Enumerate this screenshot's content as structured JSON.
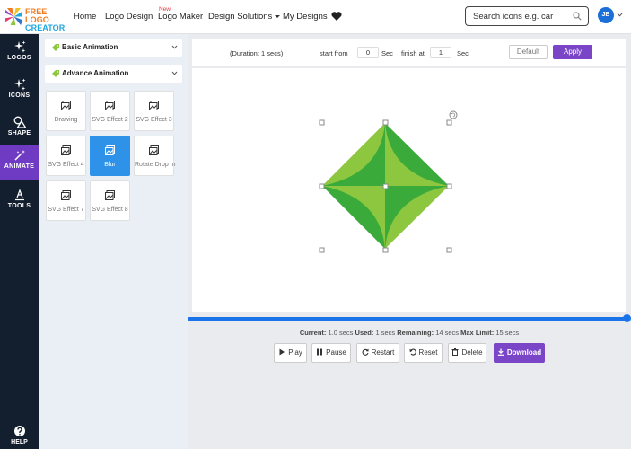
{
  "brand": {
    "line1": "FREE LOGO",
    "line2": "CREATOR"
  },
  "nav": {
    "home": "Home",
    "logo_design": "Logo Design",
    "logo_maker": "Logo Maker",
    "new_badge": "New",
    "design_solutions": "Design Solutions",
    "my_designs": "My Designs"
  },
  "search": {
    "placeholder": "Search icons e.g. car"
  },
  "user": {
    "initials": "JB"
  },
  "sidebar": {
    "items": [
      {
        "label": "LOGOS",
        "icon": "sparkle-icon"
      },
      {
        "label": "ICONS",
        "icon": "sparkle-icon"
      },
      {
        "label": "SHAPE",
        "icon": "shapes-icon"
      },
      {
        "label": "ANIMATE",
        "icon": "magic-wand-icon"
      },
      {
        "label": "TOOLS",
        "icon": "text-tool-icon"
      }
    ],
    "help": "HELP"
  },
  "panel": {
    "basic": "Basic Animation",
    "advance": "Advance Animation",
    "effects": [
      "Drawing",
      "SVG Effect 2",
      "SVG Effect 3",
      "SVG Effect 4",
      "Blur",
      "Rotate Drop In",
      "SVG Effect 7",
      "SVG Effect 8"
    ],
    "active": "Blur"
  },
  "toolbar": {
    "duration": "(Duration: 1 secs)",
    "start_from": "start from",
    "start_value": "0",
    "sec1": "Sec",
    "finish_at": "finish at",
    "finish_value": "1",
    "sec2": "Sec",
    "default": "Default",
    "apply": "Apply"
  },
  "timeline": {
    "progress": 1.0
  },
  "status": {
    "current_label": "Current:",
    "current_value": "1.0 secs",
    "used_label": "Used:",
    "used_value": "1 secs",
    "remaining_label": "Remaining:",
    "remaining_value": "14 secs",
    "max_label": "Max Limit:",
    "max_value": "15 secs"
  },
  "controls": {
    "play": "Play",
    "pause": "Pause",
    "restart": "Restart",
    "reset": "Reset",
    "delete": "Delete",
    "download": "Download"
  },
  "colors": {
    "accent": "#7a45c7",
    "sidebar": "#131e2e",
    "active_tile": "#2e93e8",
    "star_light": "#8dc63f",
    "star_dark": "#3aab3a"
  }
}
